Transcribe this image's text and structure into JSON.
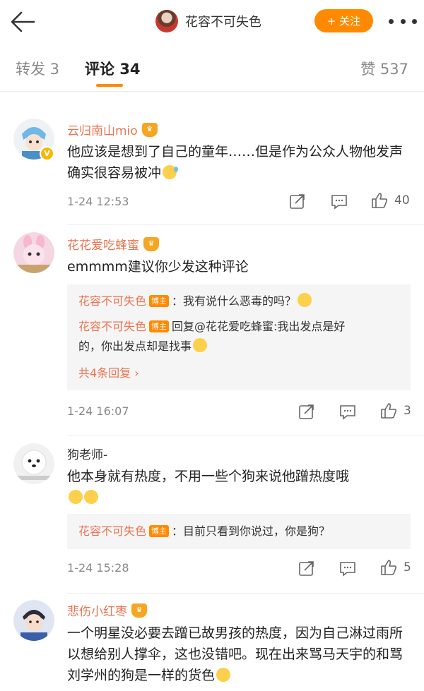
{
  "header": {
    "title": "花容不可失色",
    "follow_label": "+ 关注"
  },
  "tabs": {
    "forward": "转发 3",
    "comments": "评论 34",
    "likes": "赞 537"
  },
  "comments": [
    {
      "username": "云归南山mio",
      "text": "他应该是想到了自己的童年……但是作为公众人物他发声确实很容易被冲",
      "time": "1-24 12:53",
      "likes": "40"
    },
    {
      "username": "花花爱吃蜂蜜",
      "text": "emmmm建议你少发这种评论",
      "time": "1-24 16:07",
      "likes": "3",
      "replies": [
        {
          "name": "花容不可失色",
          "tag": "博主",
          "text": "：我有说什么恶毒的吗？"
        },
        {
          "name": "花容不可失色",
          "tag": "博主",
          "text_line1": "回复@花花爱吃蜂蜜:我出发点是好",
          "text_line2": "的，你出发点却是找事"
        }
      ],
      "more_replies": "共4条回复 ›"
    },
    {
      "username": "狗老师-",
      "text": "他本身就有热度，不用一些个狗来说他蹭热度哦",
      "time": "1-24 15:28",
      "likes": "5",
      "replies": [
        {
          "name": "花容不可失色",
          "tag": "博主",
          "text": "：目前只看到你说过，你是狗？"
        }
      ]
    },
    {
      "username": "悲伤小红枣",
      "text": "一个明星没必要去蹭已故男孩的热度，因为自己淋过雨所以想给别人撑伞，这也没错吧。现在出来骂马天宇的和骂刘学州的狗是一样的货色"
    }
  ],
  "colors": {
    "accent": "#ff8a00",
    "username": "#eb7350",
    "meta": "#888888"
  },
  "icons": [
    "back-arrow-icon",
    "more-dots-icon",
    "share-icon",
    "comment-icon",
    "like-icon",
    "verified-badge-icon",
    "crown-badge-icon"
  ]
}
